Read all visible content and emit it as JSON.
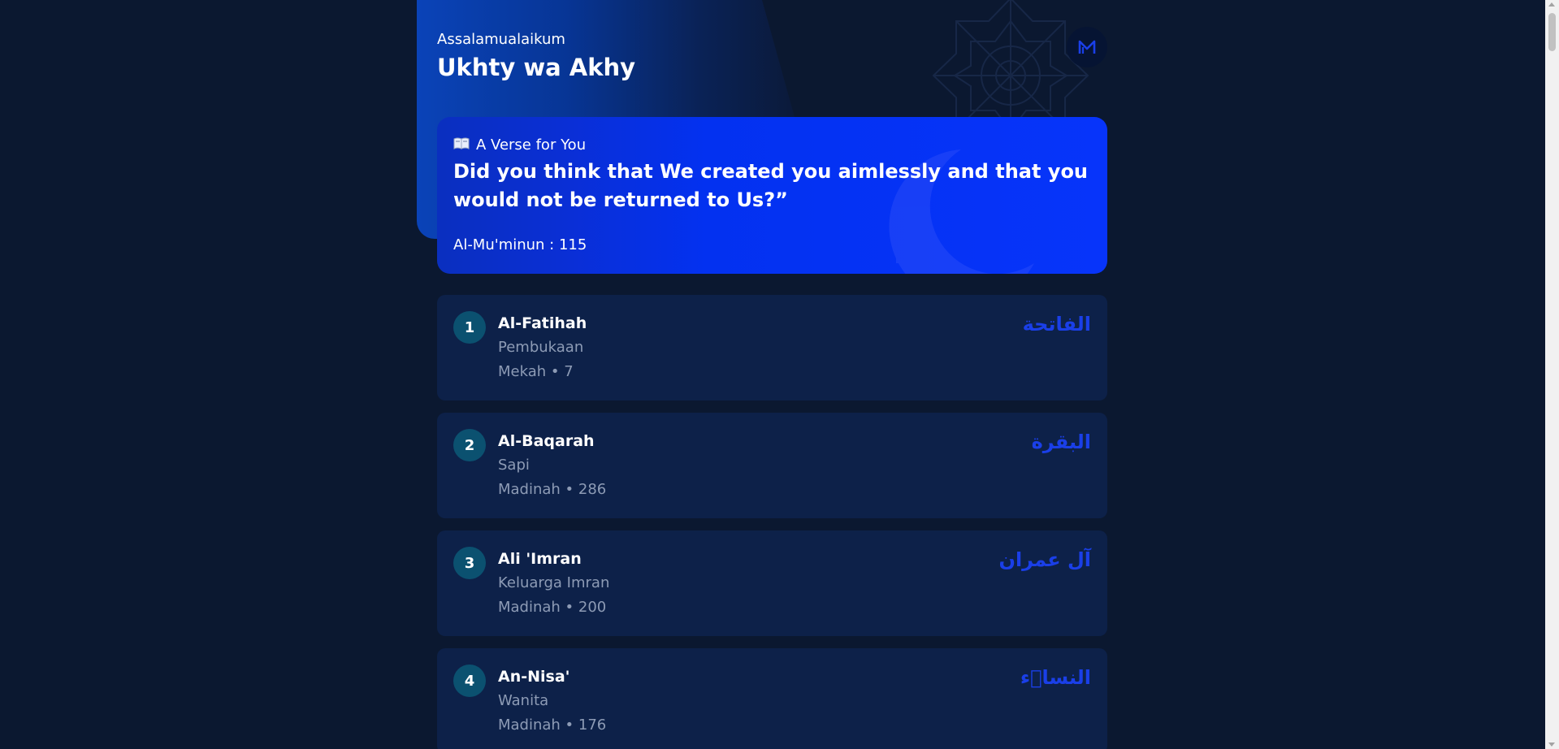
{
  "header": {
    "greeting": "Assalamualaikum",
    "username": "Ukhty wa Akhy",
    "logo_icon": "m-logo-icon"
  },
  "verse": {
    "icon": "open-book-icon",
    "label": "A Verse for You",
    "text": "Did you think that We created you aimlessly and that you would not be returned to Us?”",
    "reference": "Al-Mu'minun : 115"
  },
  "surahs": [
    {
      "number": "1",
      "name": "Al-Fatihah",
      "meaning": "Pembukaan",
      "meta": "Mekah • 7",
      "arabic": "الفاتحة"
    },
    {
      "number": "2",
      "name": "Al-Baqarah",
      "meaning": "Sapi",
      "meta": "Madinah • 286",
      "arabic": "البقرة"
    },
    {
      "number": "3",
      "name": "Ali 'Imran",
      "meaning": "Keluarga Imran",
      "meta": "Madinah • 200",
      "arabic": "آل عمران"
    },
    {
      "number": "4",
      "name": "An-Nisa'",
      "meaning": "Wanita",
      "meta": "Madinah • 176",
      "arabic": "النساۤء"
    }
  ],
  "colors": {
    "background": "#0b1830",
    "card": "#0d2149",
    "accent": "#0734fa",
    "arabic_text": "#1a3fe8",
    "number_badge": "#0b5170"
  }
}
